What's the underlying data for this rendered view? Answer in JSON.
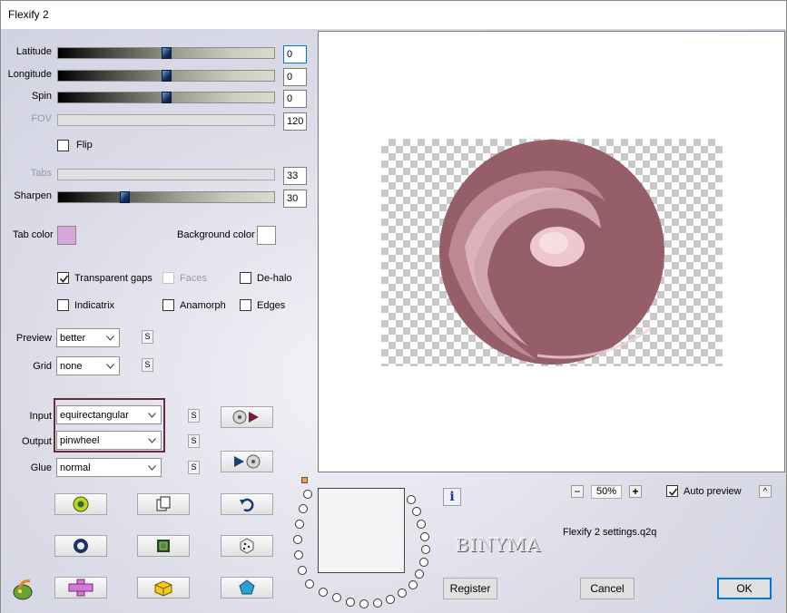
{
  "window": {
    "title": "Flexify 2"
  },
  "sliders": [
    {
      "label": "Latitude",
      "value": "0",
      "fraction": 0.5,
      "enabled": true,
      "focused": true
    },
    {
      "label": "Longitude",
      "value": "0",
      "fraction": 0.5,
      "enabled": true
    },
    {
      "label": "Spin",
      "value": "0",
      "fraction": 0.5,
      "enabled": true
    },
    {
      "label": "FOV",
      "value": "120",
      "enabled": false
    },
    {
      "label": "Tabs",
      "value": "33",
      "enabled": false
    },
    {
      "label": "Sharpen",
      "value": "30",
      "fraction": 0.3,
      "enabled": true
    }
  ],
  "flip": {
    "label": "Flip",
    "checked": false
  },
  "colors": {
    "tab_color_label": "Tab color",
    "tab_color": "#d9a6d9",
    "background_color_label": "Background color",
    "background_color": "#ffffff",
    "accent": "#0078d7",
    "sphere": "#955e69"
  },
  "options": {
    "transparent_gaps": {
      "label": "Transparent gaps",
      "checked": true
    },
    "faces": {
      "label": "Faces",
      "checked": false,
      "enabled": false
    },
    "de_halo": {
      "label": "De-halo",
      "checked": false
    },
    "indicatrix": {
      "label": "Indicatrix",
      "checked": false
    },
    "anamorph": {
      "label": "Anamorph",
      "checked": false
    },
    "edges": {
      "label": "Edges",
      "checked": false
    }
  },
  "dropdowns": {
    "preview": {
      "label": "Preview",
      "value": "better"
    },
    "grid": {
      "label": "Grid",
      "value": "none"
    },
    "input": {
      "label": "Input",
      "value": "equirectangular"
    },
    "output": {
      "label": "Output",
      "value": "pinwheel"
    },
    "glue": {
      "label": "Glue",
      "value": "normal"
    }
  },
  "s_button_label": "S",
  "zoom": {
    "minus": "−",
    "value": "50%",
    "plus": "+"
  },
  "auto_preview": {
    "label": "Auto preview",
    "checked": true
  },
  "collapse_label": "^",
  "settings_file": "Flexify 2 settings.q2q",
  "logo_text": "BINYMA",
  "info_label": "i",
  "buttons": {
    "register": "Register",
    "cancel": "Cancel",
    "ok": "OK"
  },
  "icons": [
    "randomize-icon",
    "copy-icon",
    "undo-icon",
    "ring-icon",
    "frame-icon",
    "dice-icon",
    "plugin-icon",
    "cross-icon",
    "cube-icon",
    "pentagon-icon",
    "play-to-disc-icon",
    "disc-to-play-icon"
  ]
}
